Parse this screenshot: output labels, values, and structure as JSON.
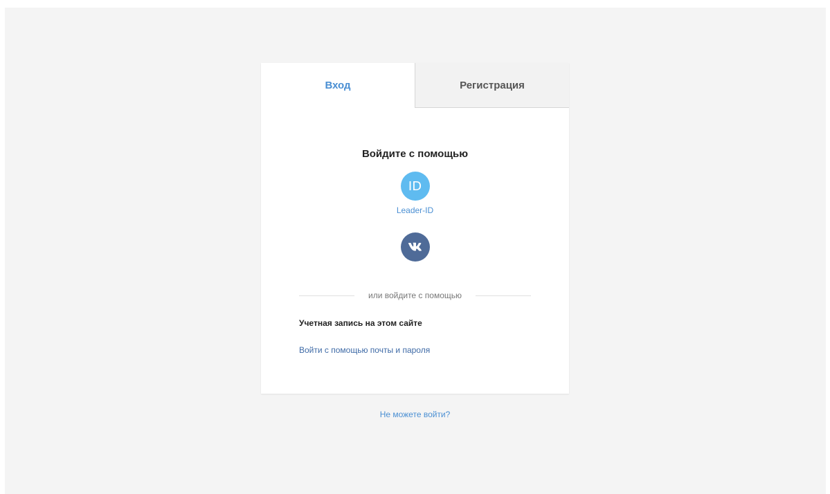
{
  "tabs": {
    "login": "Вход",
    "register": "Регистрация"
  },
  "login": {
    "heading": "Войдите с помощью",
    "providers": [
      {
        "name": "Leader-ID",
        "icon_text": "ID",
        "icon": "leader-id-icon",
        "color": "#5fbbf0"
      },
      {
        "name": "",
        "icon": "vk-icon",
        "color": "#4f6b98"
      }
    ],
    "divider_text": "или войдите с помощью",
    "account_title": "Учетная запись на этом сайте",
    "email_link": "Войти с помощью почты и пароля"
  },
  "help_link": "Не можете войти?",
  "colors": {
    "accent": "#4a8fd3",
    "background": "#f4f4f4",
    "vk": "#4f6b98",
    "leader_id": "#5fbbf0"
  }
}
